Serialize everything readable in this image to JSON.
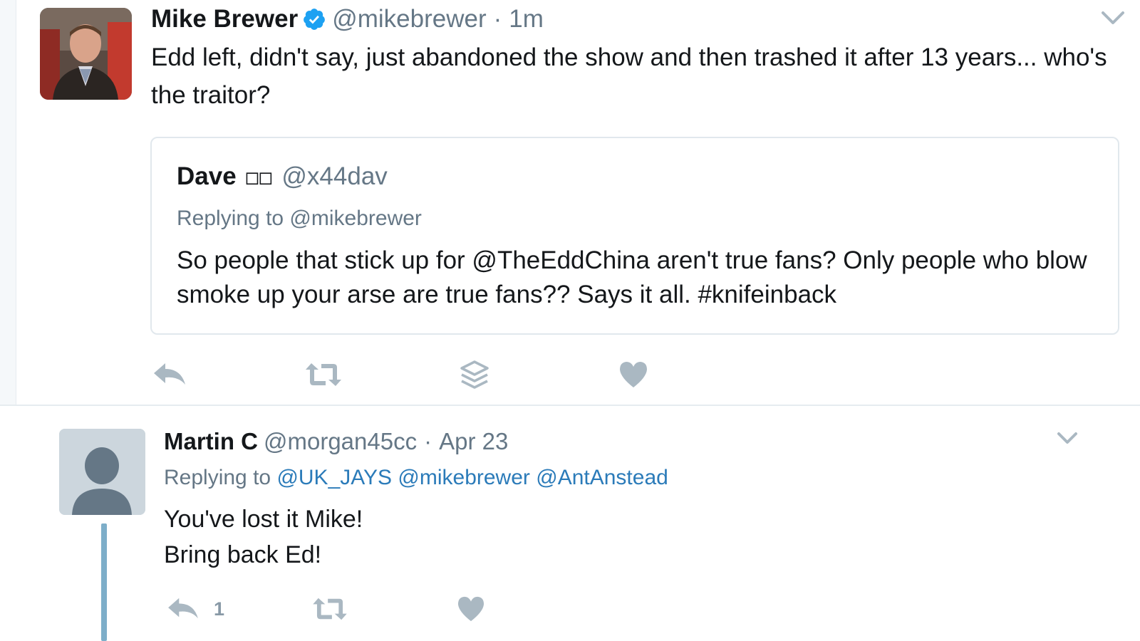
{
  "tweet1": {
    "author_name": "Mike Brewer",
    "handle": "@mikebrewer",
    "separator": "·",
    "time": "1m",
    "text": "Edd left, didn't say, just abandoned the show and then trashed it after 13 years... who's the traitor?",
    "quoted": {
      "author_name": "Dave",
      "emoji_placeholder": "□□",
      "handle": "@x44dav",
      "replying_to": "Replying to @mikebrewer",
      "text": "So people that stick up for @TheEddChina aren't true fans? Only people who blow smoke up your arse are true fans?? Says it all. #knifeinback"
    },
    "actions": [
      "reply-icon",
      "retweet-icon",
      "stack-icon",
      "heart-icon"
    ]
  },
  "tweet2": {
    "author_name": "Martin C",
    "handle": "@morgan45cc",
    "separator": "·",
    "date": "Apr 23",
    "replying_label": "Replying to",
    "mentions": [
      "@UK_JAYS",
      "@mikebrewer",
      "@AntAnstead"
    ],
    "line1": "You've lost it Mike!",
    "line2": "Bring back Ed!",
    "reply_count": "1",
    "actions": [
      "reply-icon",
      "retweet-icon",
      "heart-icon"
    ]
  },
  "colors": {
    "verified_blue": "#1da1f2",
    "muted_text": "#657786",
    "mention_blue": "#2b7bb9",
    "action_gray": "#aab8c2",
    "thread_line": "#7daec9"
  }
}
